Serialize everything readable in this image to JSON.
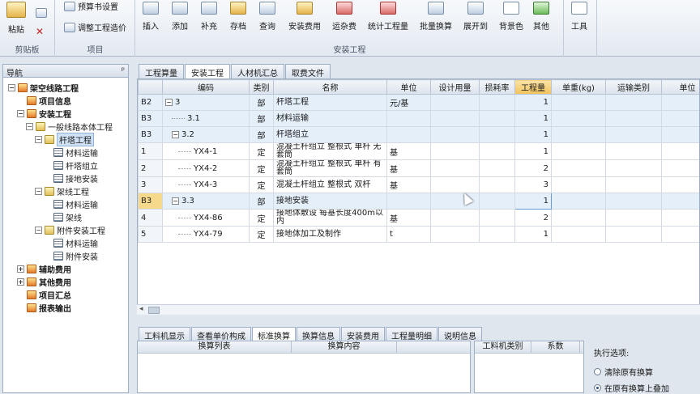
{
  "ribbon": {
    "clipboard": {
      "label": "剪贴板",
      "paste": "粘贴"
    },
    "project": {
      "label": "项目",
      "budget_settings": "预算书设置",
      "adjust_cost": "调整工程造价"
    },
    "install": {
      "label": "安装工程",
      "buttons": [
        "插入",
        "添加",
        "补充",
        "存档",
        "查询",
        "安装费用",
        "运杂费",
        "统计工程量",
        "批量换算",
        "展开到",
        "背景色",
        "其他"
      ]
    },
    "tools": {
      "label": "工具"
    }
  },
  "nav": {
    "title": "导航",
    "pin": "ᵖ",
    "items": [
      {
        "label": "架空线路工程",
        "level": 0,
        "exp": "−",
        "icon": "proj",
        "bold": true
      },
      {
        "label": "项目信息",
        "level": 1,
        "exp": "",
        "icon": "proj",
        "bold": true
      },
      {
        "label": "安装工程",
        "level": 1,
        "exp": "−",
        "icon": "proj",
        "bold": true
      },
      {
        "label": "一般线路本体工程",
        "level": 2,
        "exp": "−",
        "icon": "folder",
        "bold": false
      },
      {
        "label": "杆塔工程",
        "level": 3,
        "exp": "−",
        "icon": "folder",
        "bold": false,
        "selected": true
      },
      {
        "label": "材料运输",
        "level": 4,
        "exp": "",
        "icon": "sheet",
        "bold": false
      },
      {
        "label": "杆塔组立",
        "level": 4,
        "exp": "",
        "icon": "sheet",
        "bold": false
      },
      {
        "label": "接地安装",
        "level": 4,
        "exp": "",
        "icon": "sheet",
        "bold": false
      },
      {
        "label": "架线工程",
        "level": 3,
        "exp": "−",
        "icon": "folder",
        "bold": false
      },
      {
        "label": "材料运输",
        "level": 4,
        "exp": "",
        "icon": "sheet",
        "bold": false
      },
      {
        "label": "架线",
        "level": 4,
        "exp": "",
        "icon": "sheet",
        "bold": false
      },
      {
        "label": "附件安装工程",
        "level": 3,
        "exp": "−",
        "icon": "folder",
        "bold": false
      },
      {
        "label": "材料运输",
        "level": 4,
        "exp": "",
        "icon": "sheet",
        "bold": false
      },
      {
        "label": "附件安装",
        "level": 4,
        "exp": "",
        "icon": "sheet",
        "bold": false
      },
      {
        "label": "辅助费用",
        "level": 1,
        "exp": "+",
        "icon": "proj",
        "bold": true
      },
      {
        "label": "其他费用",
        "level": 1,
        "exp": "+",
        "icon": "proj",
        "bold": true
      },
      {
        "label": "项目汇总",
        "level": 1,
        "exp": "",
        "icon": "proj",
        "bold": true
      },
      {
        "label": "报表输出",
        "level": 1,
        "exp": "",
        "icon": "proj",
        "bold": true
      }
    ]
  },
  "tabs": [
    "工程算量",
    "安装工程",
    "人材机汇总",
    "取费文件"
  ],
  "grid": {
    "columns": [
      "",
      "编码",
      "类别",
      "名称",
      "单位",
      "设计用量",
      "损耗率",
      "工程量",
      "单重(kg)",
      "运输类别",
      "单位"
    ],
    "rows": [
      {
        "rh": "B2",
        "tree": "−",
        "code": "3",
        "type": "部",
        "name": "杆塔工程",
        "unit": "元/基",
        "qty": "1",
        "last": "",
        "hl": true
      },
      {
        "rh": "B3",
        "tree": "",
        "code": "3.1",
        "type": "部",
        "name": "材料运输",
        "unit": "",
        "qty": "1",
        "last": "",
        "hl": true
      },
      {
        "rh": "B3",
        "tree": "−",
        "code": "3.2",
        "type": "部",
        "name": "杆塔组立",
        "unit": "",
        "qty": "1",
        "last": "",
        "hl": true
      },
      {
        "rh": "1",
        "tree": "",
        "code": "YX4-1",
        "type": "定",
        "name": "混凝土杆组立 整根式 单杆 无套筒",
        "unit": "基",
        "qty": "1",
        "last": "29",
        "hl": false
      },
      {
        "rh": "2",
        "tree": "",
        "code": "YX4-2",
        "type": "定",
        "name": "混凝土杆组立 整根式 单杆 有套筒",
        "unit": "基",
        "qty": "2",
        "last": "27",
        "hl": false
      },
      {
        "rh": "3",
        "tree": "",
        "code": "YX4-3",
        "type": "定",
        "name": "混凝土杆组立 整根式 双杆",
        "unit": "基",
        "qty": "3",
        "last": "53",
        "hl": false
      },
      {
        "rh": "B3",
        "tree": "−",
        "code": "3.3",
        "type": "部",
        "name": "接地安装",
        "unit": "",
        "qty": "1",
        "last": "",
        "hl": true,
        "sel": true
      },
      {
        "rh": "4",
        "tree": "",
        "code": "YX4-86",
        "type": "定",
        "name": "接地体敷设 每基长度400m以内",
        "unit": "基",
        "qty": "2",
        "last": "-",
        "hl": false
      },
      {
        "rh": "5",
        "tree": "",
        "code": "YX4-79",
        "type": "定",
        "name": "接地体加工及制作",
        "unit": "t",
        "qty": "1",
        "last": "1!",
        "hl": false
      }
    ]
  },
  "bottom_tabs": [
    "工料机显示",
    "查看单价构成",
    "标准换算",
    "换算信息",
    "安装费用",
    "工程量明细",
    "说明信息"
  ],
  "bottom_tabs_active": 2,
  "conversion": {
    "col1": "换算列表",
    "col2": "换算内容"
  },
  "material": {
    "col1": "工料机类别",
    "col2": "系数"
  },
  "exec_options": {
    "title": "执行选项:",
    "opt1": "清除原有换算",
    "opt2": "在原有换算上叠加"
  }
}
